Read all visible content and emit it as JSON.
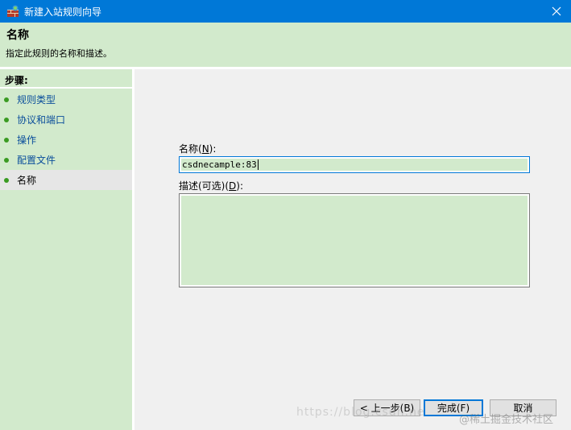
{
  "window": {
    "title": "新建入站规则向导",
    "close_label": "×"
  },
  "header": {
    "title": "名称",
    "subtitle": "指定此规则的名称和描述。"
  },
  "sidebar": {
    "heading": "步骤:",
    "items": [
      {
        "label": "规则类型",
        "active": false
      },
      {
        "label": "协议和端口",
        "active": false
      },
      {
        "label": "操作",
        "active": false
      },
      {
        "label": "配置文件",
        "active": false
      },
      {
        "label": "名称",
        "active": true
      }
    ]
  },
  "form": {
    "name_label_prefix": "名称(",
    "name_label_key": "N",
    "name_label_suffix": "):",
    "name_value": "csdnecample:83",
    "desc_label_prefix": "描述(可选)(",
    "desc_label_key": "D",
    "desc_label_suffix": "):",
    "desc_value": ""
  },
  "buttons": {
    "back": "< 上一步(B)",
    "finish": "完成(F)",
    "cancel": "取消"
  },
  "watermark": {
    "url": "https://blog.csdn.ne",
    "source": "@稀土掘金技术社区"
  },
  "colors": {
    "titlebar": "#0078d7",
    "panel_green": "#d2eacc",
    "link_blue": "#0a4e9b",
    "bullet_green": "#3a9b22"
  }
}
